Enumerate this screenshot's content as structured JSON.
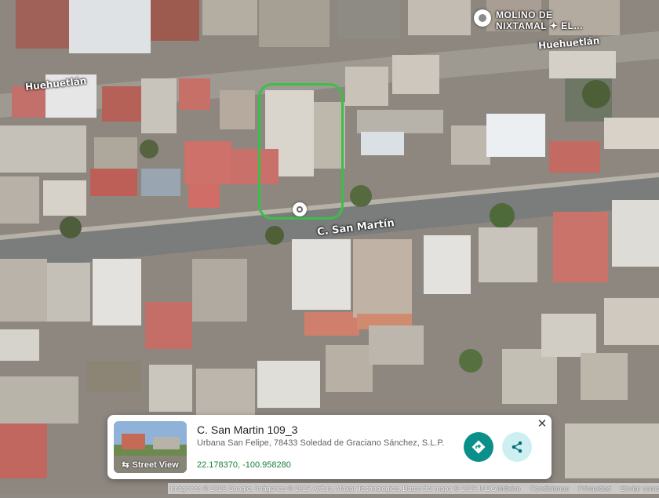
{
  "map": {
    "streets": {
      "upper_left": "Huehuetlán",
      "upper_right": "Huehuetlán",
      "main": "C. San Martín"
    },
    "poi": {
      "name_line1": "MOLINO DE",
      "name_line2": "NIXTAMAL ✦ EL...",
      "icon": "place-pin-icon"
    },
    "selection_color": "#3cbf4a"
  },
  "place_card": {
    "title": "C. San Martin 109_3",
    "address": "Urbana San Felipe, 78433 Soledad de Graciano Sánchez, S.L.P.",
    "coordinates": "22.178370, -100.958280",
    "street_view_label": "Street View",
    "directions_icon": "directions-icon",
    "share_icon": "share-icon",
    "close_label": "✕",
    "accent": "#0b8f8a"
  },
  "footer": {
    "attribution": "Imágenes © 2025 Google, Imágenes © 2025 Airbus, Maxar Technologies, Datos del mapa © 2025 INEGI",
    "country": "México",
    "terms": "Condiciones",
    "privacy": "Privacidad",
    "feedback": "Enviar comentarios"
  }
}
